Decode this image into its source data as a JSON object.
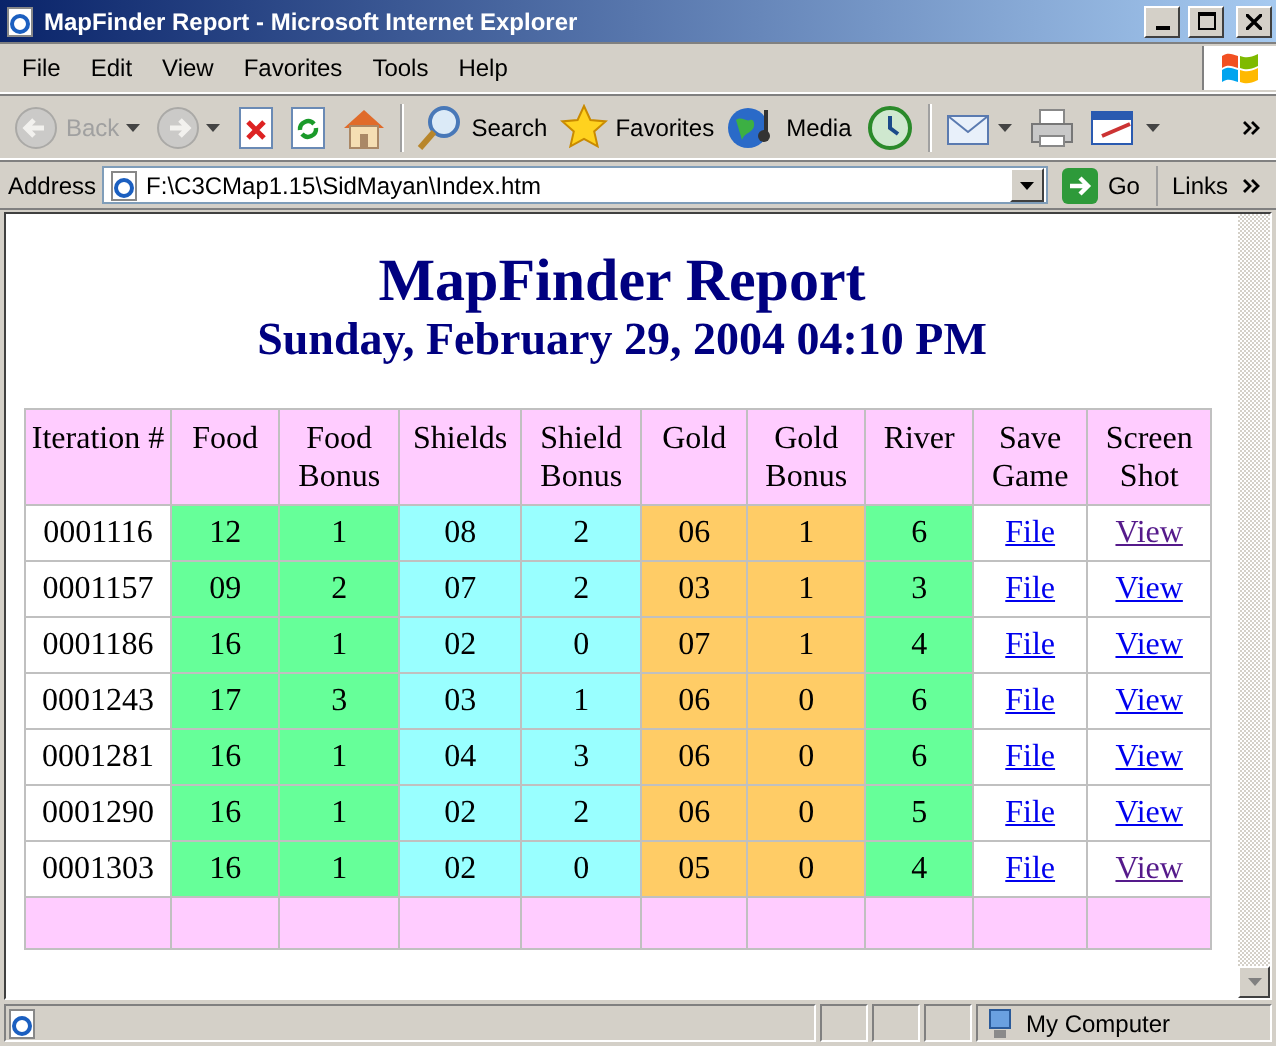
{
  "window": {
    "title": "MapFinder Report - Microsoft Internet Explorer"
  },
  "menu": [
    "File",
    "Edit",
    "View",
    "Favorites",
    "Tools",
    "Help"
  ],
  "toolbar": [
    {
      "kind": "back",
      "label": "Back",
      "disabled": true
    },
    {
      "kind": "forward",
      "disabled": true
    },
    {
      "kind": "stop",
      "disabled": false
    },
    {
      "kind": "refresh",
      "disabled": false
    },
    {
      "kind": "home",
      "disabled": false
    },
    {
      "kind": "search",
      "label": "Search",
      "disabled": false
    },
    {
      "kind": "favorites",
      "label": "Favorites",
      "disabled": false
    },
    {
      "kind": "media",
      "label": "Media",
      "disabled": false
    },
    {
      "kind": "history",
      "disabled": false
    },
    {
      "kind": "mail",
      "disabled": false
    },
    {
      "kind": "print",
      "disabled": false
    },
    {
      "kind": "edit",
      "disabled": false
    }
  ],
  "address": {
    "label": "Address",
    "value": "F:\\C3CMap1.15\\SidMayan\\Index.htm",
    "go": "Go",
    "links": "Links"
  },
  "report": {
    "title": "MapFinder Report",
    "date": "Sunday, February 29, 2004 04:10 PM",
    "columns": [
      {
        "label": "Iteration #"
      },
      {
        "label": "Food",
        "color": "#66ff99"
      },
      {
        "label": "Food Bonus",
        "color": "#66ff99"
      },
      {
        "label": "Shields",
        "color": "#99ffff"
      },
      {
        "label": "Shield Bonus",
        "color": "#99ffff"
      },
      {
        "label": "Gold",
        "color": "#ffcc66"
      },
      {
        "label": "Gold Bonus",
        "color": "#ffcc66"
      },
      {
        "label": "River",
        "color": "#66ff99"
      },
      {
        "label": "Save Game"
      },
      {
        "label": "Screen Shot"
      }
    ],
    "rows": [
      {
        "iteration": "0001116",
        "values": [
          "12",
          "1",
          "08",
          "2",
          "06",
          "1",
          "6"
        ],
        "save": {
          "text": "File",
          "visited": false
        },
        "shot": {
          "text": "View",
          "visited": true
        }
      },
      {
        "iteration": "0001157",
        "values": [
          "09",
          "2",
          "07",
          "2",
          "03",
          "1",
          "3"
        ],
        "save": {
          "text": "File",
          "visited": false
        },
        "shot": {
          "text": "View",
          "visited": false
        }
      },
      {
        "iteration": "0001186",
        "values": [
          "16",
          "1",
          "02",
          "0",
          "07",
          "1",
          "4"
        ],
        "save": {
          "text": "File",
          "visited": false
        },
        "shot": {
          "text": "View",
          "visited": false
        }
      },
      {
        "iteration": "0001243",
        "values": [
          "17",
          "3",
          "03",
          "1",
          "06",
          "0",
          "6"
        ],
        "save": {
          "text": "File",
          "visited": false
        },
        "shot": {
          "text": "View",
          "visited": false
        }
      },
      {
        "iteration": "0001281",
        "values": [
          "16",
          "1",
          "04",
          "3",
          "06",
          "0",
          "6"
        ],
        "save": {
          "text": "File",
          "visited": false
        },
        "shot": {
          "text": "View",
          "visited": false
        }
      },
      {
        "iteration": "0001290",
        "values": [
          "16",
          "1",
          "02",
          "2",
          "06",
          "0",
          "5"
        ],
        "save": {
          "text": "File",
          "visited": false
        },
        "shot": {
          "text": "View",
          "visited": false
        }
      },
      {
        "iteration": "0001303",
        "values": [
          "16",
          "1",
          "02",
          "0",
          "05",
          "0",
          "4"
        ],
        "save": {
          "text": "File",
          "visited": false
        },
        "shot": {
          "text": "View",
          "visited": true
        }
      }
    ]
  },
  "status": {
    "zone": "My Computer"
  }
}
